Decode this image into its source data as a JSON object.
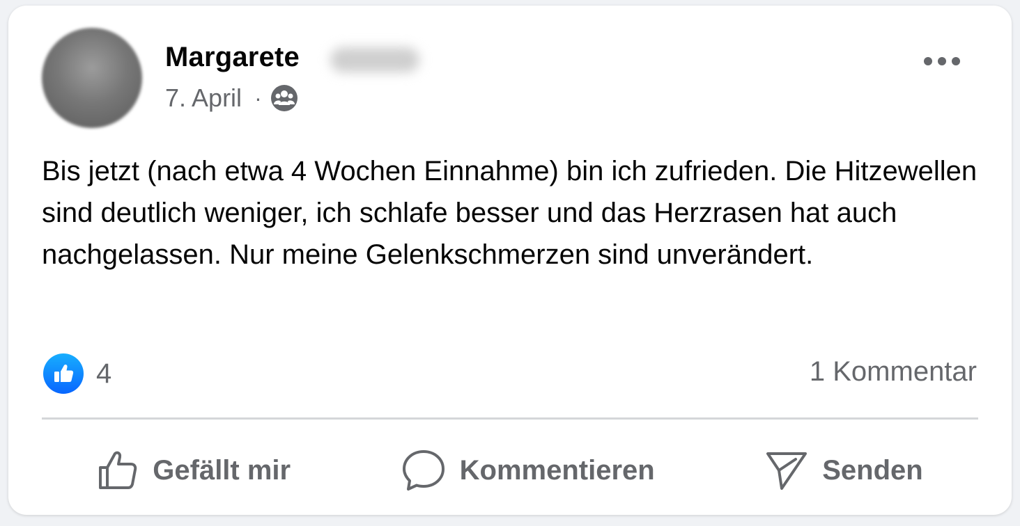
{
  "post": {
    "author_first_name": "Margarete",
    "author_last_name_redacted": true,
    "date": "7. April",
    "separator": "·",
    "audience_icon": "group-icon",
    "more_icon": "more-options-icon",
    "text": "Bis jetzt (nach etwa 4 Wochen Einnahme) bin ich zufrieden. Die Hitzewellen sind deutlich weniger, ich schlafe besser und das Herzrasen hat auch nachgelassen. Nur meine Gelenkschmerzen sind unverändert."
  },
  "stats": {
    "reaction_icon": "like-reaction-icon",
    "reaction_count": "4",
    "comments_label": "1 Kommentar"
  },
  "actions": {
    "like_label": "Gefällt mir",
    "comment_label": "Kommentieren",
    "send_label": "Senden"
  },
  "colors": {
    "text_primary": "#050505",
    "text_secondary": "#65676b",
    "like_blue": "#0866ff",
    "divider": "#d4d6d9",
    "card_bg": "#ffffff"
  }
}
